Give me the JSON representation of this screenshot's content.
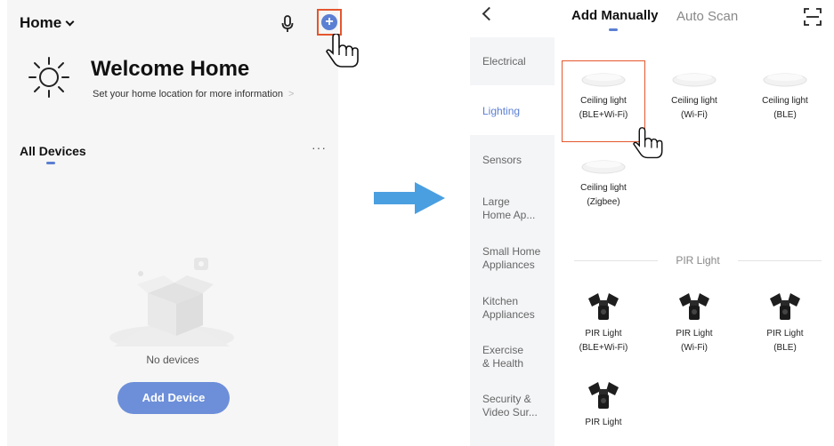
{
  "left": {
    "home_label": "Home",
    "welcome_title": "Welcome Home",
    "welcome_subtitle": "Set your home location for more information",
    "all_devices_label": "All Devices",
    "more_label": "···",
    "no_devices_text": "No devices",
    "add_device_label": "Add Device"
  },
  "right": {
    "tab_manual": "Add Manually",
    "tab_auto": "Auto Scan",
    "sidebar": [
      {
        "label": "Electrical"
      },
      {
        "label": "Lighting"
      },
      {
        "label": "Sensors"
      },
      {
        "label": "Large\nHome Ap..."
      },
      {
        "label": "Small Home\nAppliances"
      },
      {
        "label": "Kitchen\nAppliances"
      },
      {
        "label": "Exercise\n& Health"
      },
      {
        "label": "Security &\nVideo Sur..."
      }
    ],
    "ceiling": [
      {
        "name": "Ceiling light",
        "proto": "(BLE+Wi-Fi)"
      },
      {
        "name": "Ceiling light",
        "proto": "(Wi-Fi)"
      },
      {
        "name": "Ceiling light",
        "proto": "(BLE)"
      },
      {
        "name": "Ceiling light",
        "proto": "(Zigbee)"
      }
    ],
    "section_pir": "PIR Light",
    "pir": [
      {
        "name": "PIR Light",
        "proto": "(BLE+Wi-Fi)"
      },
      {
        "name": "PIR Light",
        "proto": "(Wi-Fi)"
      },
      {
        "name": "PIR Light",
        "proto": "(BLE)"
      },
      {
        "name": "PIR Light",
        "proto": ""
      }
    ]
  },
  "colors": {
    "accent": "#5b7fd3",
    "highlight": "#e4572e",
    "arrow": "#4a9fe0"
  }
}
